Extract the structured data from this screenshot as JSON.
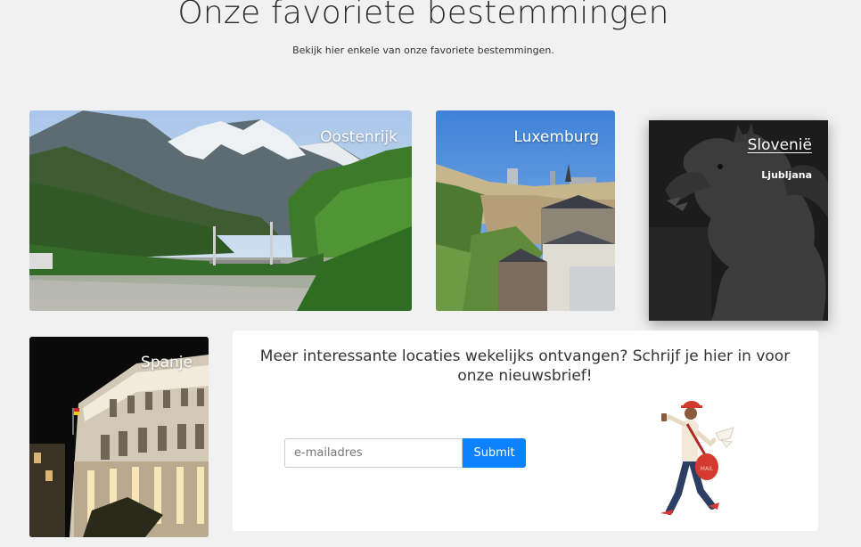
{
  "page": {
    "title": "Onze favoriete bestemmingen",
    "subtitle": "Bekijk hier enkele van onze favoriete bestemmingen."
  },
  "destinations": [
    {
      "label": "Oostenrijk"
    },
    {
      "label": "Luxemburg"
    },
    {
      "label": "Slovenië",
      "caption": "Ljubljana"
    },
    {
      "label": "Spanje"
    }
  ],
  "newsletter": {
    "text": "Meer interessante locaties wekelijks ontvangen? Schrijf je hier in voor onze nieuwsbrief!",
    "email_placeholder": "e-mailadres",
    "submit_label": "Submit",
    "bag_text": "MAIL"
  },
  "colors": {
    "background": "#f1f1f1",
    "accent": "#0d82ff",
    "mail_red": "#d43a2f",
    "dark_overlay": "#1c1c1c"
  }
}
